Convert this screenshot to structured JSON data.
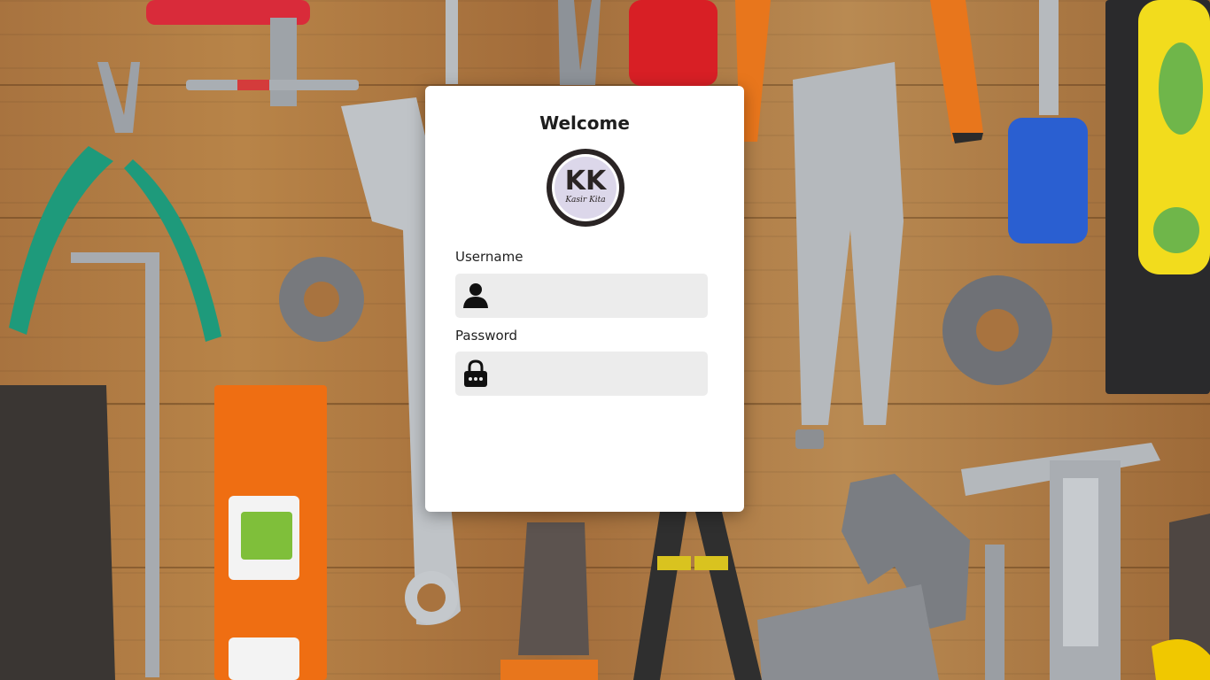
{
  "login": {
    "title": "Welcome",
    "logo_text": "KK",
    "logo_subtext": "Kasir Kita",
    "username_label": "Username",
    "username_value": "",
    "password_label": "Password",
    "password_value": ""
  },
  "icons": {
    "username": "user-icon",
    "password": "lock-icon"
  },
  "colors": {
    "card_bg": "#ffffff",
    "input_bg": "#ececec",
    "title": "#1e1e1e",
    "logo_bg": "#dcd7ea",
    "logo_ring": "#2a2424"
  }
}
